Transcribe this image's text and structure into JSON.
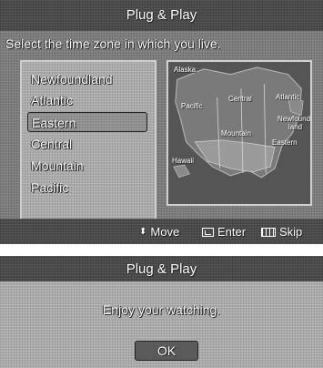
{
  "setup": {
    "title": "Plug & Play",
    "prompt": "Select the time zone in which you live.",
    "time_zones": [
      "Newfoundland",
      "Atlantic",
      "Eastern",
      "Central",
      "Mountain",
      "Pacific"
    ],
    "selected_time_zone": "Eastern",
    "map_labels": {
      "alaska": "Alaska",
      "pacific": "Pacific",
      "central": "Central",
      "atlantic": "Atlantic",
      "mountain": "Mountain",
      "newfoundland_1": "Newfound-",
      "newfoundland_2": "land",
      "eastern": "Eastern",
      "hawaii": "Hawaii"
    },
    "footer": {
      "move_label": "Move",
      "enter_label": "Enter",
      "skip_label": "Skip",
      "move_icon": "up-down-arrows-icon",
      "enter_icon": "enter-icon",
      "skip_icon": "skip-icon"
    }
  },
  "finish": {
    "title": "Plug & Play",
    "message": "Enjoy your watching.",
    "ok_label": "OK"
  }
}
